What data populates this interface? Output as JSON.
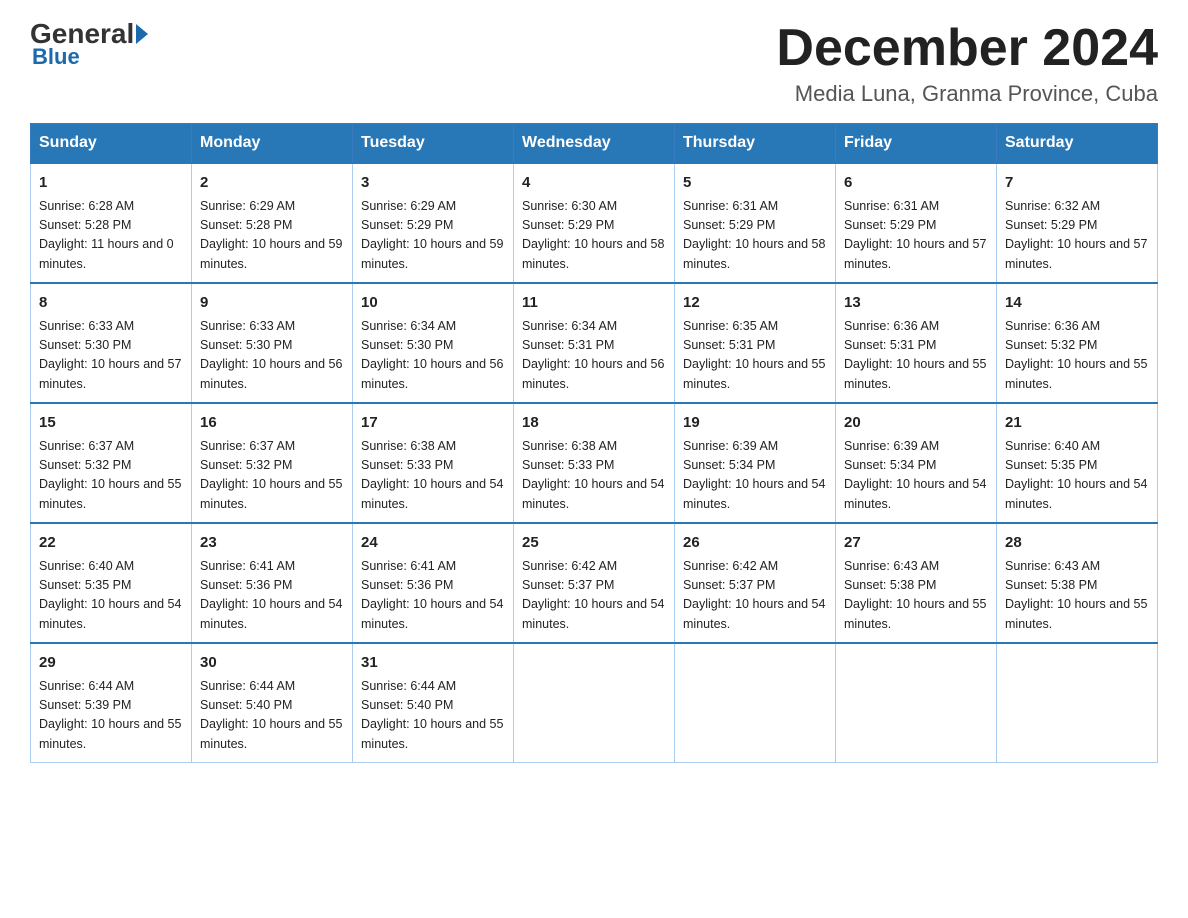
{
  "logo": {
    "general": "General",
    "blue": "Blue",
    "subtitle": "Blue"
  },
  "header": {
    "title": "December 2024",
    "location": "Media Luna, Granma Province, Cuba"
  },
  "days_header": [
    "Sunday",
    "Monday",
    "Tuesday",
    "Wednesday",
    "Thursday",
    "Friday",
    "Saturday"
  ],
  "weeks": [
    [
      {
        "num": "1",
        "sunrise": "6:28 AM",
        "sunset": "5:28 PM",
        "daylight": "11 hours and 0 minutes."
      },
      {
        "num": "2",
        "sunrise": "6:29 AM",
        "sunset": "5:28 PM",
        "daylight": "10 hours and 59 minutes."
      },
      {
        "num": "3",
        "sunrise": "6:29 AM",
        "sunset": "5:29 PM",
        "daylight": "10 hours and 59 minutes."
      },
      {
        "num": "4",
        "sunrise": "6:30 AM",
        "sunset": "5:29 PM",
        "daylight": "10 hours and 58 minutes."
      },
      {
        "num": "5",
        "sunrise": "6:31 AM",
        "sunset": "5:29 PM",
        "daylight": "10 hours and 58 minutes."
      },
      {
        "num": "6",
        "sunrise": "6:31 AM",
        "sunset": "5:29 PM",
        "daylight": "10 hours and 57 minutes."
      },
      {
        "num": "7",
        "sunrise": "6:32 AM",
        "sunset": "5:29 PM",
        "daylight": "10 hours and 57 minutes."
      }
    ],
    [
      {
        "num": "8",
        "sunrise": "6:33 AM",
        "sunset": "5:30 PM",
        "daylight": "10 hours and 57 minutes."
      },
      {
        "num": "9",
        "sunrise": "6:33 AM",
        "sunset": "5:30 PM",
        "daylight": "10 hours and 56 minutes."
      },
      {
        "num": "10",
        "sunrise": "6:34 AM",
        "sunset": "5:30 PM",
        "daylight": "10 hours and 56 minutes."
      },
      {
        "num": "11",
        "sunrise": "6:34 AM",
        "sunset": "5:31 PM",
        "daylight": "10 hours and 56 minutes."
      },
      {
        "num": "12",
        "sunrise": "6:35 AM",
        "sunset": "5:31 PM",
        "daylight": "10 hours and 55 minutes."
      },
      {
        "num": "13",
        "sunrise": "6:36 AM",
        "sunset": "5:31 PM",
        "daylight": "10 hours and 55 minutes."
      },
      {
        "num": "14",
        "sunrise": "6:36 AM",
        "sunset": "5:32 PM",
        "daylight": "10 hours and 55 minutes."
      }
    ],
    [
      {
        "num": "15",
        "sunrise": "6:37 AM",
        "sunset": "5:32 PM",
        "daylight": "10 hours and 55 minutes."
      },
      {
        "num": "16",
        "sunrise": "6:37 AM",
        "sunset": "5:32 PM",
        "daylight": "10 hours and 55 minutes."
      },
      {
        "num": "17",
        "sunrise": "6:38 AM",
        "sunset": "5:33 PM",
        "daylight": "10 hours and 54 minutes."
      },
      {
        "num": "18",
        "sunrise": "6:38 AM",
        "sunset": "5:33 PM",
        "daylight": "10 hours and 54 minutes."
      },
      {
        "num": "19",
        "sunrise": "6:39 AM",
        "sunset": "5:34 PM",
        "daylight": "10 hours and 54 minutes."
      },
      {
        "num": "20",
        "sunrise": "6:39 AM",
        "sunset": "5:34 PM",
        "daylight": "10 hours and 54 minutes."
      },
      {
        "num": "21",
        "sunrise": "6:40 AM",
        "sunset": "5:35 PM",
        "daylight": "10 hours and 54 minutes."
      }
    ],
    [
      {
        "num": "22",
        "sunrise": "6:40 AM",
        "sunset": "5:35 PM",
        "daylight": "10 hours and 54 minutes."
      },
      {
        "num": "23",
        "sunrise": "6:41 AM",
        "sunset": "5:36 PM",
        "daylight": "10 hours and 54 minutes."
      },
      {
        "num": "24",
        "sunrise": "6:41 AM",
        "sunset": "5:36 PM",
        "daylight": "10 hours and 54 minutes."
      },
      {
        "num": "25",
        "sunrise": "6:42 AM",
        "sunset": "5:37 PM",
        "daylight": "10 hours and 54 minutes."
      },
      {
        "num": "26",
        "sunrise": "6:42 AM",
        "sunset": "5:37 PM",
        "daylight": "10 hours and 54 minutes."
      },
      {
        "num": "27",
        "sunrise": "6:43 AM",
        "sunset": "5:38 PM",
        "daylight": "10 hours and 55 minutes."
      },
      {
        "num": "28",
        "sunrise": "6:43 AM",
        "sunset": "5:38 PM",
        "daylight": "10 hours and 55 minutes."
      }
    ],
    [
      {
        "num": "29",
        "sunrise": "6:44 AM",
        "sunset": "5:39 PM",
        "daylight": "10 hours and 55 minutes."
      },
      {
        "num": "30",
        "sunrise": "6:44 AM",
        "sunset": "5:40 PM",
        "daylight": "10 hours and 55 minutes."
      },
      {
        "num": "31",
        "sunrise": "6:44 AM",
        "sunset": "5:40 PM",
        "daylight": "10 hours and 55 minutes."
      },
      null,
      null,
      null,
      null
    ]
  ]
}
